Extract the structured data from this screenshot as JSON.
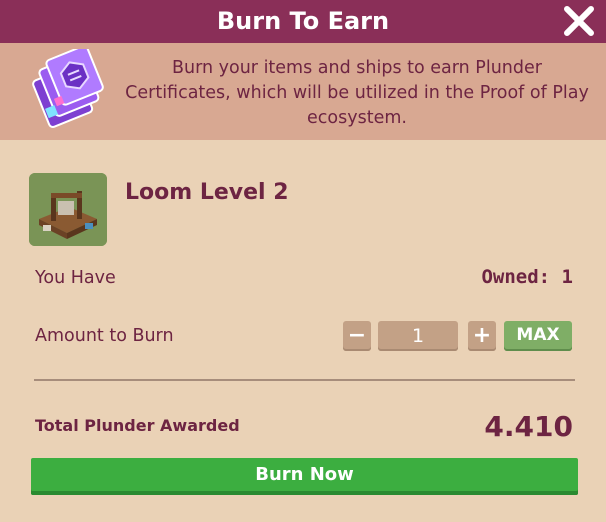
{
  "header": {
    "title": "Burn To Earn",
    "close_icon": "close-icon"
  },
  "banner": {
    "icon": "plunder-certificate-icon",
    "description": "Burn your items and ships to earn Plunder Certificates, which will be utilized in the Proof of Play ecosystem."
  },
  "item": {
    "icon": "loom-building-icon",
    "name": "Loom Level 2"
  },
  "you_have": {
    "label": "You Have",
    "owned_text": "Owned: 1"
  },
  "amount": {
    "label": "Amount to Burn",
    "minus_label": "−",
    "value": "1",
    "plus_label": "+",
    "max_label": "MAX"
  },
  "total": {
    "label": "Total Plunder Awarded",
    "value": "4.410"
  },
  "burn_button": {
    "label": "Burn Now"
  },
  "colors": {
    "header_bg": "#8a2f58",
    "banner_bg": "#d8a892",
    "panel_bg": "#ead2b6",
    "text_primary": "#6d2442",
    "burn_green": "#3cae40",
    "max_green": "#7fae66"
  }
}
